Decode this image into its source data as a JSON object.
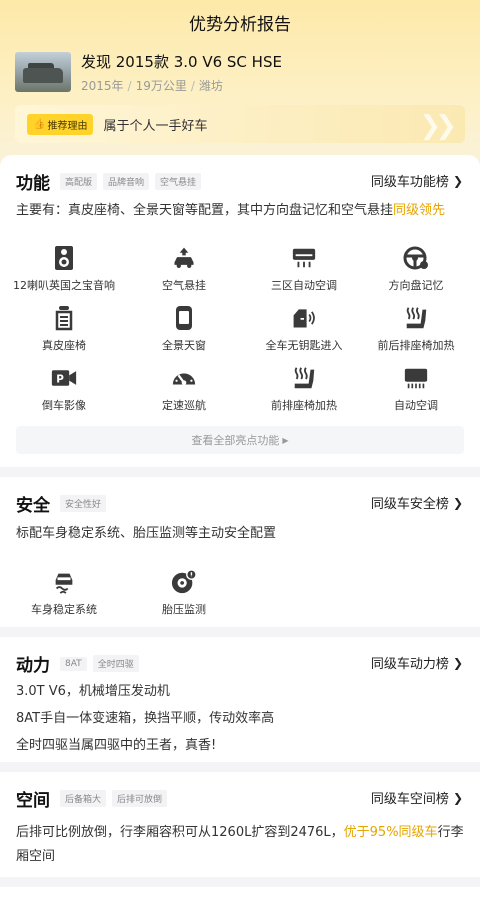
{
  "header": {
    "title": "优势分析报告"
  },
  "car": {
    "name": "发现 2015款 3.0 V6 SC HSE",
    "year": "2015年",
    "mileage": "19万公里",
    "city": "潍坊",
    "separator": "/"
  },
  "reason": {
    "tag": "推荐理由",
    "text": "属于个人一手好车"
  },
  "sections": {
    "function": {
      "title": "功能",
      "tags": [
        "高配版",
        "品牌音响",
        "空气悬挂"
      ],
      "rank_link": "同级车功能榜",
      "desc_prefix": "主要有：真皮座椅、全景天窗等配置，其中方向盘记忆和空气悬挂",
      "desc_highlight": "同级领先",
      "features": [
        {
          "label": "12喇叭英国之宝音响",
          "icon": "speaker-icon"
        },
        {
          "label": "空气悬挂",
          "icon": "air-suspension-icon"
        },
        {
          "label": "三区自动空调",
          "icon": "climate-control-icon"
        },
        {
          "label": "方向盘记忆",
          "icon": "steering-wheel-icon"
        },
        {
          "label": "真皮座椅",
          "icon": "leather-seat-icon"
        },
        {
          "label": "全景天窗",
          "icon": "sunroof-icon"
        },
        {
          "label": "全车无钥匙进入",
          "icon": "keyless-entry-icon"
        },
        {
          "label": "前后排座椅加热",
          "icon": "seat-heating-icon"
        },
        {
          "label": "倒车影像",
          "icon": "reverse-camera-icon"
        },
        {
          "label": "定速巡航",
          "icon": "cruise-control-icon"
        },
        {
          "label": "前排座椅加热",
          "icon": "front-seat-heating-icon"
        },
        {
          "label": "自动空调",
          "icon": "auto-ac-icon"
        }
      ],
      "more": "查看全部亮点功能"
    },
    "safety": {
      "title": "安全",
      "tags": [
        "安全性好"
      ],
      "rank_link": "同级车安全榜",
      "desc": "标配车身稳定系统、胎压监测等主动安全配置",
      "features": [
        {
          "label": "车身稳定系统",
          "icon": "stability-control-icon"
        },
        {
          "label": "胎压监测",
          "icon": "tire-pressure-icon"
        }
      ]
    },
    "power": {
      "title": "动力",
      "tags": [
        "8AT",
        "全时四驱"
      ],
      "rank_link": "同级车动力榜",
      "lines": [
        "3.0T V6，机械增压发动机",
        "8AT手自一体变速箱，换挡平顺，传动效率高",
        "全时四驱当属四驱中的王者，真香!"
      ]
    },
    "space": {
      "title": "空间",
      "tags": [
        "后备箱大",
        "后排可放倒"
      ],
      "rank_link": "同级车空间榜",
      "desc_prefix": "后排可比例放倒，行李厢容积可从1260L扩容到2476L，",
      "desc_highlight": "优于95%同级车",
      "desc_suffix": "行李厢空间"
    }
  }
}
